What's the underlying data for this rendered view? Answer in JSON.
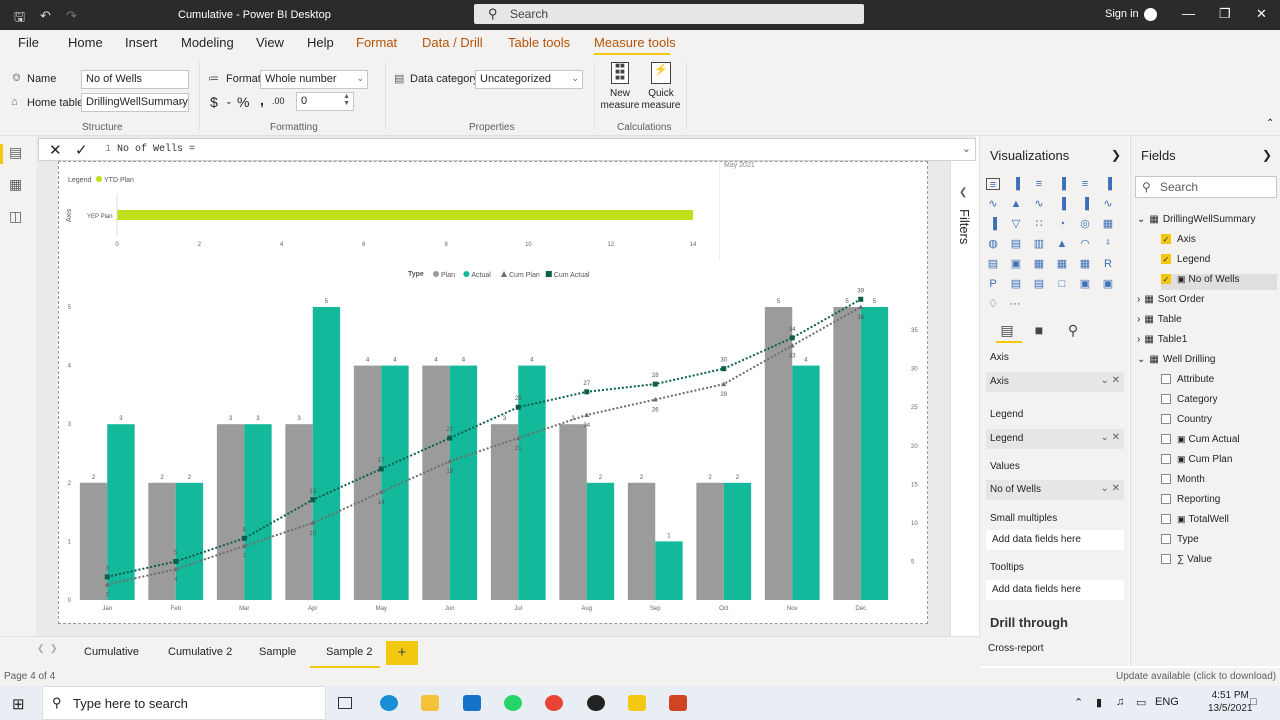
{
  "titlebar": {
    "title": "Cumulative - Power BI Desktop",
    "search_placeholder": "Search",
    "signin": "Sign in"
  },
  "menu": [
    "File",
    "Home",
    "Insert",
    "Modeling",
    "View",
    "Help",
    "Format",
    "Data / Drill",
    "Table tools",
    "Measure tools"
  ],
  "ribbon": {
    "name_label": "Name",
    "name_value": "No of Wells",
    "home_table_label": "Home table",
    "home_table_value": "DrillingWellSummary",
    "format_label": "Format",
    "format_value": "Whole number",
    "currency": "$",
    "percent": "%",
    "comma": ",",
    "decimals_icon": ".00",
    "decimals_value": "0",
    "data_category_label": "Data category",
    "data_category_value": "Uncategorized",
    "new_measure": "New measure",
    "quick_measure": "Quick measure",
    "groups": {
      "structure": "Structure",
      "formatting": "Formatting",
      "properties": "Properties",
      "calculations": "Calculations"
    }
  },
  "formula": {
    "line": "1",
    "text": "No of Wells ="
  },
  "small_chart": {
    "legend_label": "Legend",
    "legend_item": "YTD Plan",
    "bar_label": "YEP Plan",
    "axis_title": "Axis",
    "date_label": "May 2021"
  },
  "chart_data": {
    "type": "bar",
    "legend_title": "Type",
    "categories": [
      "Jan",
      "Feb",
      "Mar",
      "Apr",
      "May",
      "Jun",
      "Jul",
      "Aug",
      "Sep",
      "Oct",
      "Nov",
      "Dec"
    ],
    "series": [
      {
        "name": "Plan",
        "kind": "bar",
        "color": "#9b9b9b",
        "values": [
          2,
          2,
          3,
          3,
          4,
          4,
          3,
          3,
          2,
          2,
          5,
          5
        ]
      },
      {
        "name": "Actual",
        "kind": "bar",
        "color": "#14b89a",
        "values": [
          3,
          2,
          3,
          5,
          4,
          4,
          4,
          2,
          1,
          2,
          4,
          5
        ]
      },
      {
        "name": "Cum Plan",
        "kind": "line",
        "color": "#6e6e6e",
        "values": [
          2,
          4,
          7,
          10,
          14,
          18,
          21,
          24,
          26,
          28,
          33,
          38
        ]
      },
      {
        "name": "Cum Actual",
        "kind": "line",
        "color": "#0b5e4a",
        "values": [
          3,
          5,
          8,
          13,
          17,
          21,
          25,
          27,
          28,
          30,
          34,
          39
        ]
      }
    ],
    "y_left": {
      "ticks": [
        "0",
        "1",
        "2",
        "3",
        "4",
        "5"
      ],
      "lim": [
        0,
        5
      ]
    },
    "y_right": {
      "ticks": [
        "5",
        "10",
        "15",
        "20",
        "25",
        "30",
        "35"
      ],
      "lim": [
        0,
        38
      ]
    },
    "small": {
      "type": "bar",
      "orientation": "horizontal",
      "category": "YEP Plan",
      "value": 14,
      "x_ticks": [
        "0",
        "2",
        "4",
        "6",
        "8",
        "10",
        "12",
        "14"
      ],
      "xlim": [
        0,
        14
      ]
    }
  },
  "filters": {
    "label": "Filters"
  },
  "viz": {
    "title": "Visualizations",
    "axis_heading": "Axis",
    "axis_field": "Axis",
    "legend_heading": "Legend",
    "legend_field": "Legend",
    "values_heading": "Values",
    "values_field": "No of Wells",
    "small_multiples_heading": "Small multiples",
    "small_multiples_add": "Add data fields here",
    "tooltips_heading": "Tooltips",
    "tooltips_add": "Add data fields here",
    "drill_heading": "Drill through",
    "cross_report": "Cross-report",
    "ellipsis": "···"
  },
  "fields": {
    "title": "Fields",
    "search_placeholder": "Search",
    "tables": [
      {
        "name": "DrillingWellSummary",
        "items": [
          {
            "name": "Axis",
            "checked": true
          },
          {
            "name": "Legend",
            "checked": true
          },
          {
            "name": "No of Wells",
            "checked": true
          }
        ]
      },
      {
        "name": "Sort Order"
      },
      {
        "name": "Table"
      },
      {
        "name": "Table1"
      },
      {
        "name": "Well Drilling",
        "items": [
          {
            "name": "Attribute"
          },
          {
            "name": "Category"
          },
          {
            "name": "Country"
          },
          {
            "name": "Cum Actual"
          },
          {
            "name": "Cum Plan"
          },
          {
            "name": "Month"
          },
          {
            "name": "Reporting"
          },
          {
            "name": "TotalWell"
          },
          {
            "name": "Type"
          },
          {
            "name": "Value"
          }
        ]
      }
    ]
  },
  "tabs": [
    "Cumulative",
    "Cumulative 2",
    "Sample",
    "Sample 2"
  ],
  "status": {
    "page": "Page 4 of 4",
    "update": "Update available (click to download)"
  },
  "taskbar": {
    "search_placeholder": "Type here to search",
    "lang": "ENG",
    "time": "4:51 PM",
    "date": "13/5/2021"
  }
}
